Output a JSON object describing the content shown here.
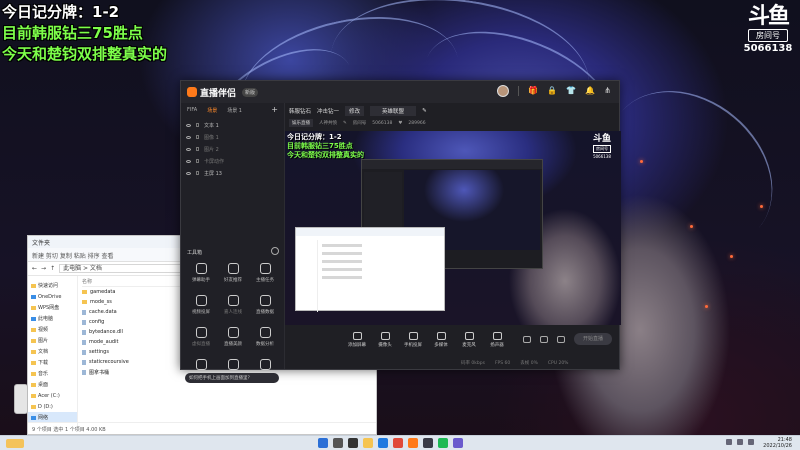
{
  "overlay": {
    "line1": "今日记分牌：1-2",
    "line2": "目前韩服钻三75胜点",
    "line3": "今天和楚钧双排整真实的"
  },
  "watermark": {
    "mark": "斗鱼",
    "room_label": "房间号",
    "room_number": "5066138"
  },
  "app": {
    "name": "直播伴侣",
    "version": "新版",
    "tabs": [
      "FIFA",
      "场景",
      "场景 1"
    ],
    "active_tab": 1,
    "add_icon": "plus-icon",
    "scenes": [
      {
        "label": "文本 1",
        "dim": false
      },
      {
        "label": "图像 1",
        "dim": true
      },
      {
        "label": "图片 2",
        "dim": true
      },
      {
        "label": "卡屏动作",
        "dim": true
      },
      {
        "label": "主屏 13",
        "dim": false
      }
    ],
    "tools_title": "工具箱",
    "tools": [
      {
        "label": "弹幕助手",
        "icon": "danmaku-icon",
        "dim": false
      },
      {
        "label": "好友推荐",
        "icon": "friend-icon",
        "dim": false
      },
      {
        "label": "主播任务",
        "icon": "task-icon",
        "dim": false
      },
      {
        "label": "视频投屏",
        "icon": "cast-icon",
        "dim": false
      },
      {
        "label": "嘉人连线",
        "icon": "link-icon",
        "dim": true
      },
      {
        "label": "直播数据",
        "icon": "data-icon",
        "dim": false
      },
      {
        "label": "虚拟直播",
        "icon": "virtual-icon",
        "dim": true
      },
      {
        "label": "直播美颜",
        "icon": "beauty-icon",
        "dim": false
      },
      {
        "label": "数据分析",
        "icon": "analysis-icon",
        "dim": false
      },
      {
        "label": "",
        "icon": "music-icon",
        "dim": false
      },
      {
        "label": "",
        "icon": "game-icon",
        "dim": false
      },
      {
        "label": "",
        "icon": "gift-icon",
        "dim": false
      }
    ],
    "tip": "如何把手机上画面加到直播里？",
    "info": {
      "title": "韩服钻石",
      "title_suffix": "冲击钻一",
      "category_btn": "修改",
      "category": "英雄联盟",
      "room_type": "娱乐直播",
      "mode": "人神共愤",
      "room_label": "房间号",
      "room_number": "5066138",
      "fans": "289966"
    },
    "preview": {
      "line1": "今日记分牌：1-2",
      "line2": "目前韩服钻三75胜点",
      "line3": "今天和楚钧双排整真实的"
    },
    "controls": [
      {
        "label": "添加屏幕",
        "icon": "screen-icon"
      },
      {
        "label": "摄像头",
        "icon": "camera-icon"
      },
      {
        "label": "手机投屏",
        "icon": "phone-icon"
      },
      {
        "label": "多媒体",
        "icon": "media-icon"
      },
      {
        "label": "麦克风",
        "icon": "mic-icon"
      },
      {
        "label": "扬声器",
        "icon": "speaker-icon"
      }
    ],
    "start_live": "开始直播",
    "status": [
      "码率 0kbps",
      "FPS 60",
      "丢帧 0%",
      "CPU 20%"
    ]
  },
  "explorer": {
    "title": "文件夹",
    "ribbon": "新建  剪切  复制  粘贴  排序  查看",
    "address": "此电脑 > 文档",
    "sidebar": [
      "快速访问",
      "OneDrive",
      "WPS网盘",
      "此电脑",
      "视频",
      "图片",
      "文档",
      "下载",
      "音乐",
      "桌面",
      "Acer (C:)",
      "D (D:)",
      "网络"
    ],
    "column_header": "名称",
    "files": [
      "gamedata",
      "mode_ss",
      "cache.data",
      "config",
      "bytedance.dll",
      "mode_audit",
      "settings",
      "staticrecoursive",
      "图拿书桶"
    ],
    "status": "9 个项目   选中 1 个项目  4.00 KB"
  },
  "taskbar": {
    "time": "21:48",
    "date": "2022/10/26"
  },
  "colors": {
    "accent": "#ff8a2a",
    "overlay_green": "#7dff4a",
    "app_bg": "#1f1f24"
  }
}
